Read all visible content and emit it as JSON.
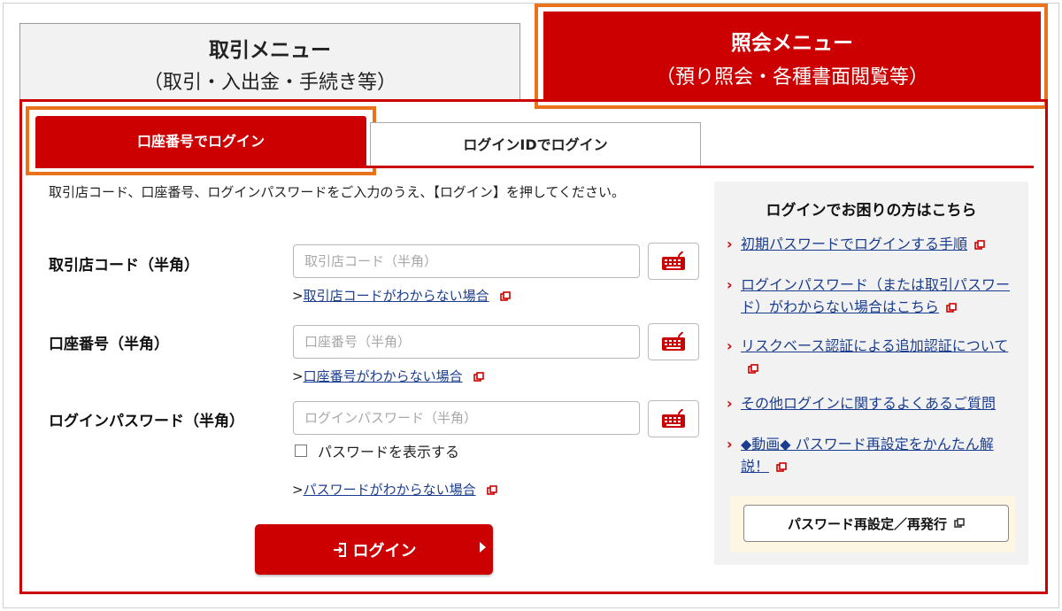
{
  "top_menu": {
    "trade": {
      "title": "取引メニュー",
      "subtitle": "（取引・入出金・手続き等）"
    },
    "inquiry": {
      "title": "照会メニュー",
      "subtitle": "（預り照会・各種書面閲覧等）"
    }
  },
  "tabs": {
    "account_login": "口座番号でログイン",
    "loginid_login": "ログインIDでログイン"
  },
  "intro": "取引店コード、口座番号、ログインパスワードをご入力のうえ、【ログイン】を押してください。",
  "fields": {
    "branch": {
      "label": "取引店コード（半角）",
      "placeholder": "取引店コード（半角）",
      "help_prefix": ">",
      "help_link": "取引店コードがわからない場合"
    },
    "account": {
      "label": "口座番号（半角）",
      "placeholder": "口座番号（半角）",
      "help_prefix": ">",
      "help_link": "口座番号がわからない場合"
    },
    "password": {
      "label": "ログインパスワード（半角）",
      "placeholder": "ログインパスワード（半角）",
      "show_label": "パスワードを表示する",
      "help_prefix": ">",
      "help_link": "パスワードがわからない場合"
    }
  },
  "login_button": "ログイン",
  "side": {
    "title": "ログインでお困りの方はこちら",
    "items": [
      "初期パスワードでログインする手順",
      "ログインパスワード（または取引パスワード）がわからない場合はこちら",
      "リスクベース認証による追加認証について",
      "その他ログインに関するよくあるご質問",
      "◆動画◆ パスワード再設定をかんたん解説！"
    ],
    "reset_button": "パスワード再設定／再発行"
  },
  "colors": {
    "accent": "#cc0000",
    "highlight": "#e8731a",
    "link": "#1a3d8f"
  },
  "icons": [
    "keyboard-icon",
    "external-link-icon",
    "login-door-icon",
    "chevron-right-icon"
  ]
}
